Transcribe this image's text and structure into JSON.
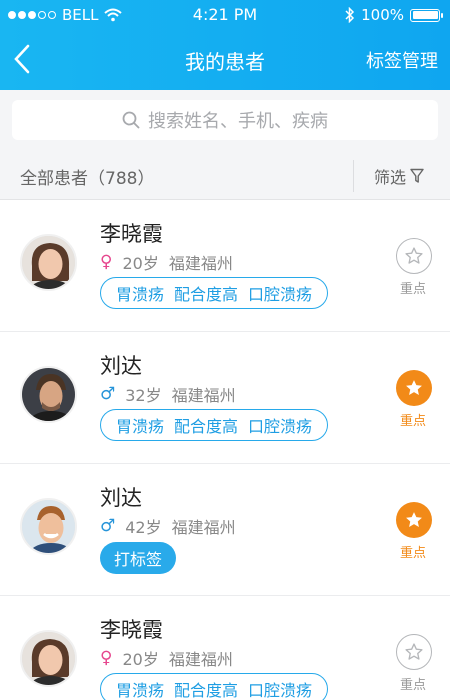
{
  "status_bar": {
    "carrier": "BELL",
    "time": "4:21 PM",
    "battery": "100%"
  },
  "nav": {
    "title": "我的患者",
    "action": "标签管理"
  },
  "search": {
    "placeholder": "搜索姓名、手机、疾病"
  },
  "filter_bar": {
    "count_label": "全部患者（788）",
    "filter_label": "筛选"
  },
  "patients": [
    {
      "name": "李晓霞",
      "gender": "female",
      "gender_symbol": "♀",
      "age": "20岁",
      "location": "福建福州",
      "tags": [
        "胃溃疡",
        "配合度高",
        "口腔溃疡"
      ],
      "starred": false,
      "star_label": "重点"
    },
    {
      "name": "刘达",
      "gender": "male",
      "gender_symbol": "♂",
      "age": "32岁",
      "location": "福建福州",
      "tags": [
        "胃溃疡",
        "配合度高",
        "口腔溃疡"
      ],
      "starred": true,
      "star_label": "重点"
    },
    {
      "name": "刘达",
      "gender": "male",
      "gender_symbol": "♂",
      "age": "42岁",
      "location": "福建福州",
      "tag_button": "打标签",
      "starred": true,
      "star_label": "重点"
    },
    {
      "name": "李晓霞",
      "gender": "female",
      "gender_symbol": "♀",
      "age": "20岁",
      "location": "福建福州",
      "tags": [
        "胃溃疡",
        "配合度高",
        "口腔溃疡"
      ],
      "starred": false,
      "star_label": "重点"
    }
  ],
  "colors": {
    "header": "#19b6f2",
    "accent": "#27a9ea",
    "star_on": "#f28a18",
    "female": "#e6468e",
    "male": "#2694d9"
  }
}
